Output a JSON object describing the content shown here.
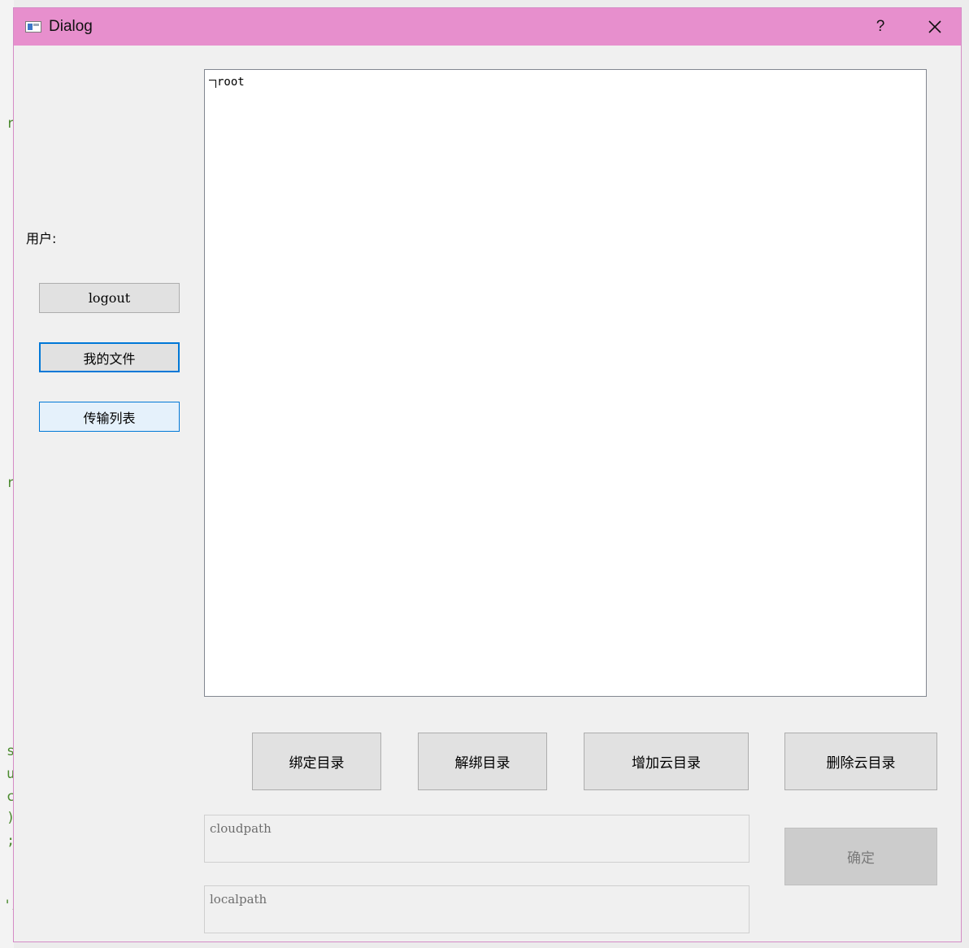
{
  "window": {
    "title": "Dialog",
    "help_label": "?"
  },
  "sidebar": {
    "user_label": "用户:",
    "logout_label": "logout",
    "my_files_label": "我的文件",
    "transfer_list_label": "传输列表"
  },
  "tree": {
    "root_label": "root"
  },
  "actions": {
    "bind_dir": "绑定目录",
    "unbind_dir": "解绑目录",
    "add_cloud_dir": "增加云目录",
    "delete_cloud_dir": "删除云目录"
  },
  "inputs": {
    "cloudpath_placeholder": "cloudpath",
    "localpath_placeholder": "localpath"
  },
  "confirm_label": "确定",
  "background_glyphs": [
    "r",
    "r",
    "s",
    "u",
    "c",
    ")",
    ";",
    "'i"
  ],
  "colors": {
    "titlebar": "#e78fcd",
    "accent": "#0078d7",
    "hover_fill": "#e5f1fb"
  }
}
